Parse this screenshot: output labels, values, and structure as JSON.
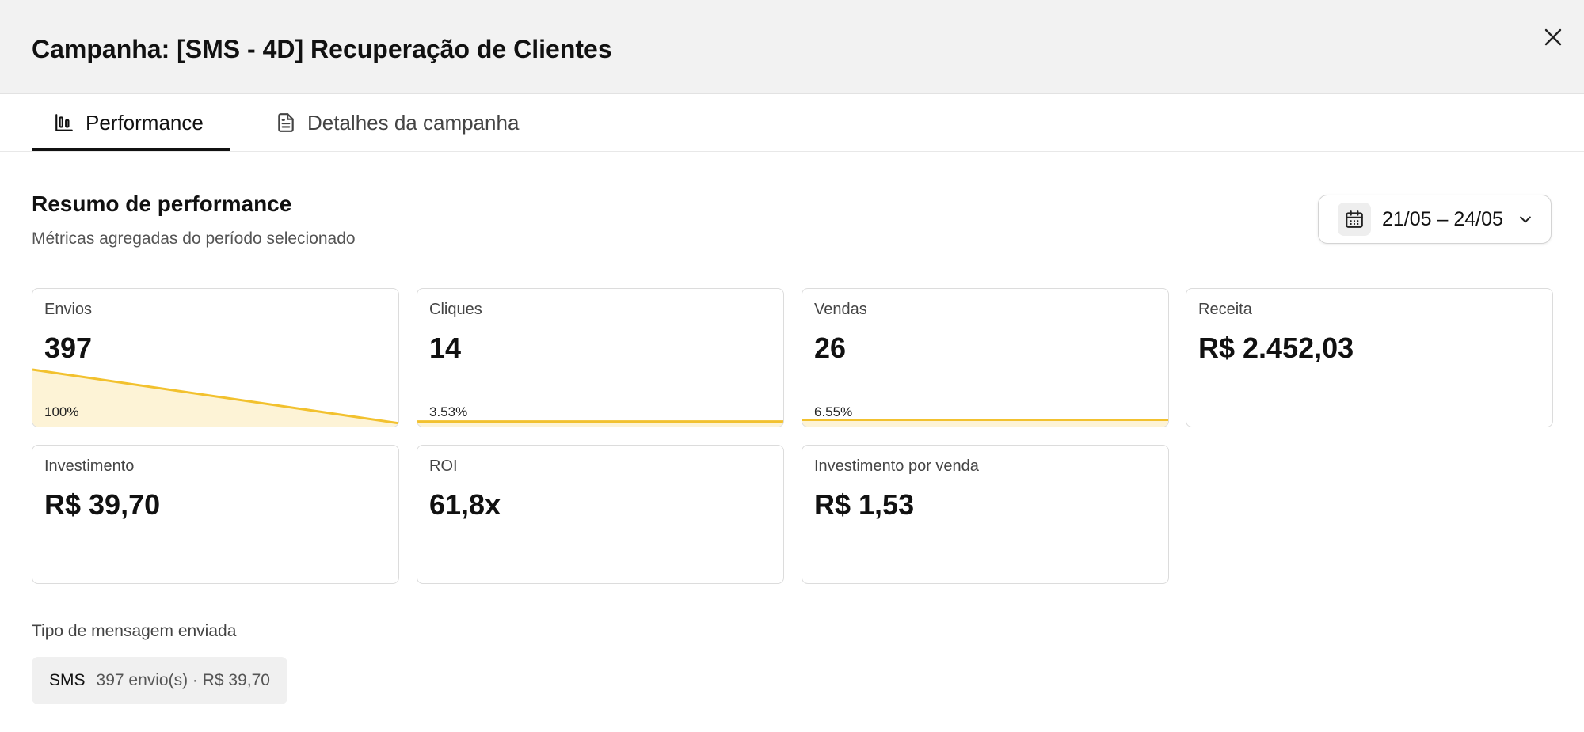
{
  "modal": {
    "title": "Campanha: [SMS - 4D] Recuperação de Clientes",
    "close_icon": "close-icon"
  },
  "tabs": [
    {
      "label": "Performance",
      "icon": "bar-chart-icon",
      "active": true
    },
    {
      "label": "Detalhes da campanha",
      "icon": "document-icon",
      "active": false
    }
  ],
  "summary": {
    "title": "Resumo de performance",
    "subtitle": "Métricas agregadas do período selecionado"
  },
  "date_range": {
    "label": "21/05 – 24/05",
    "icon": "calendar-icon"
  },
  "colors": {
    "accent": "#f2c12e",
    "accent_fill": "#fdf3d6"
  },
  "metrics": [
    {
      "label": "Envios",
      "value": "397",
      "percent": "100%",
      "fraction": 1.0
    },
    {
      "label": "Cliques",
      "value": "14",
      "percent": "3.53%",
      "fraction": 0.0353
    },
    {
      "label": "Vendas",
      "value": "26",
      "percent": "6.55%",
      "fraction": 0.0655
    },
    {
      "label": "Receita",
      "value": "R$ 2.452,03"
    },
    {
      "label": "Investimento",
      "value": "R$ 39,70"
    },
    {
      "label": "ROI",
      "value": "61,8x"
    },
    {
      "label": "Investimento por venda",
      "value": "R$ 1,53"
    }
  ],
  "message_types": {
    "label": "Tipo de mensagem enviada",
    "items": [
      {
        "type": "SMS",
        "detail": "397 envio(s) · R$ 39,70"
      }
    ]
  }
}
